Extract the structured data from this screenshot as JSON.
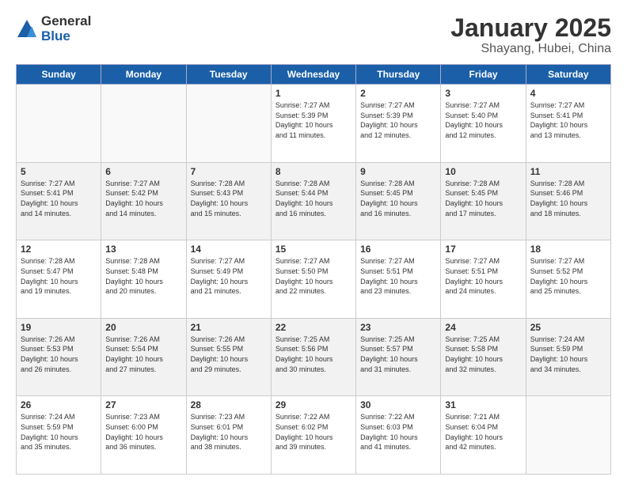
{
  "header": {
    "logo_general": "General",
    "logo_blue": "Blue",
    "month_title": "January 2025",
    "location": "Shayang, Hubei, China"
  },
  "days_of_week": [
    "Sunday",
    "Monday",
    "Tuesday",
    "Wednesday",
    "Thursday",
    "Friday",
    "Saturday"
  ],
  "weeks": [
    [
      {
        "num": "",
        "info": ""
      },
      {
        "num": "",
        "info": ""
      },
      {
        "num": "",
        "info": ""
      },
      {
        "num": "1",
        "info": "Sunrise: 7:27 AM\nSunset: 5:39 PM\nDaylight: 10 hours\nand 11 minutes."
      },
      {
        "num": "2",
        "info": "Sunrise: 7:27 AM\nSunset: 5:39 PM\nDaylight: 10 hours\nand 12 minutes."
      },
      {
        "num": "3",
        "info": "Sunrise: 7:27 AM\nSunset: 5:40 PM\nDaylight: 10 hours\nand 12 minutes."
      },
      {
        "num": "4",
        "info": "Sunrise: 7:27 AM\nSunset: 5:41 PM\nDaylight: 10 hours\nand 13 minutes."
      }
    ],
    [
      {
        "num": "5",
        "info": "Sunrise: 7:27 AM\nSunset: 5:41 PM\nDaylight: 10 hours\nand 14 minutes."
      },
      {
        "num": "6",
        "info": "Sunrise: 7:27 AM\nSunset: 5:42 PM\nDaylight: 10 hours\nand 14 minutes."
      },
      {
        "num": "7",
        "info": "Sunrise: 7:28 AM\nSunset: 5:43 PM\nDaylight: 10 hours\nand 15 minutes."
      },
      {
        "num": "8",
        "info": "Sunrise: 7:28 AM\nSunset: 5:44 PM\nDaylight: 10 hours\nand 16 minutes."
      },
      {
        "num": "9",
        "info": "Sunrise: 7:28 AM\nSunset: 5:45 PM\nDaylight: 10 hours\nand 16 minutes."
      },
      {
        "num": "10",
        "info": "Sunrise: 7:28 AM\nSunset: 5:45 PM\nDaylight: 10 hours\nand 17 minutes."
      },
      {
        "num": "11",
        "info": "Sunrise: 7:28 AM\nSunset: 5:46 PM\nDaylight: 10 hours\nand 18 minutes."
      }
    ],
    [
      {
        "num": "12",
        "info": "Sunrise: 7:28 AM\nSunset: 5:47 PM\nDaylight: 10 hours\nand 19 minutes."
      },
      {
        "num": "13",
        "info": "Sunrise: 7:28 AM\nSunset: 5:48 PM\nDaylight: 10 hours\nand 20 minutes."
      },
      {
        "num": "14",
        "info": "Sunrise: 7:27 AM\nSunset: 5:49 PM\nDaylight: 10 hours\nand 21 minutes."
      },
      {
        "num": "15",
        "info": "Sunrise: 7:27 AM\nSunset: 5:50 PM\nDaylight: 10 hours\nand 22 minutes."
      },
      {
        "num": "16",
        "info": "Sunrise: 7:27 AM\nSunset: 5:51 PM\nDaylight: 10 hours\nand 23 minutes."
      },
      {
        "num": "17",
        "info": "Sunrise: 7:27 AM\nSunset: 5:51 PM\nDaylight: 10 hours\nand 24 minutes."
      },
      {
        "num": "18",
        "info": "Sunrise: 7:27 AM\nSunset: 5:52 PM\nDaylight: 10 hours\nand 25 minutes."
      }
    ],
    [
      {
        "num": "19",
        "info": "Sunrise: 7:26 AM\nSunset: 5:53 PM\nDaylight: 10 hours\nand 26 minutes."
      },
      {
        "num": "20",
        "info": "Sunrise: 7:26 AM\nSunset: 5:54 PM\nDaylight: 10 hours\nand 27 minutes."
      },
      {
        "num": "21",
        "info": "Sunrise: 7:26 AM\nSunset: 5:55 PM\nDaylight: 10 hours\nand 29 minutes."
      },
      {
        "num": "22",
        "info": "Sunrise: 7:25 AM\nSunset: 5:56 PM\nDaylight: 10 hours\nand 30 minutes."
      },
      {
        "num": "23",
        "info": "Sunrise: 7:25 AM\nSunset: 5:57 PM\nDaylight: 10 hours\nand 31 minutes."
      },
      {
        "num": "24",
        "info": "Sunrise: 7:25 AM\nSunset: 5:58 PM\nDaylight: 10 hours\nand 32 minutes."
      },
      {
        "num": "25",
        "info": "Sunrise: 7:24 AM\nSunset: 5:59 PM\nDaylight: 10 hours\nand 34 minutes."
      }
    ],
    [
      {
        "num": "26",
        "info": "Sunrise: 7:24 AM\nSunset: 5:59 PM\nDaylight: 10 hours\nand 35 minutes."
      },
      {
        "num": "27",
        "info": "Sunrise: 7:23 AM\nSunset: 6:00 PM\nDaylight: 10 hours\nand 36 minutes."
      },
      {
        "num": "28",
        "info": "Sunrise: 7:23 AM\nSunset: 6:01 PM\nDaylight: 10 hours\nand 38 minutes."
      },
      {
        "num": "29",
        "info": "Sunrise: 7:22 AM\nSunset: 6:02 PM\nDaylight: 10 hours\nand 39 minutes."
      },
      {
        "num": "30",
        "info": "Sunrise: 7:22 AM\nSunset: 6:03 PM\nDaylight: 10 hours\nand 41 minutes."
      },
      {
        "num": "31",
        "info": "Sunrise: 7:21 AM\nSunset: 6:04 PM\nDaylight: 10 hours\nand 42 minutes."
      },
      {
        "num": "",
        "info": ""
      }
    ]
  ]
}
